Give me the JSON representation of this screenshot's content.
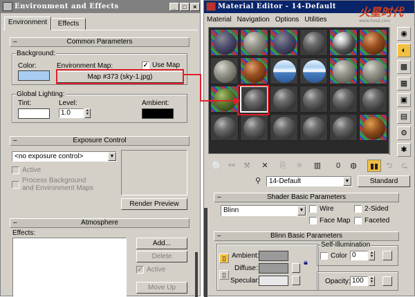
{
  "env_window": {
    "title": "Environment and Effects",
    "tabs": [
      "Environment",
      "Effects"
    ],
    "common_params": {
      "header": "Common Parameters",
      "background_group": "Background:",
      "color_label": "Color:",
      "color_value": "#a9cdf2",
      "env_map_label": "Environment Map:",
      "use_map_label": "Use Map",
      "use_map_checked": true,
      "map_button": "Map #373 (sky-1.jpg)",
      "global_lighting_group": "Global Lighting:",
      "tint_label": "Tint:",
      "level_label": "Level:",
      "level_value": "1.0",
      "ambient_label": "Ambient:"
    },
    "exposure": {
      "header": "Exposure Control",
      "dropdown": "<no exposure control>",
      "active_label": "Active",
      "process_bg_label_1": "Process Background",
      "process_bg_label_2": "and Environment Maps",
      "render_preview": "Render Preview"
    },
    "atmosphere": {
      "header": "Atmosphere",
      "effects_label": "Effects:",
      "add": "Add...",
      "delete": "Delete",
      "active_label": "Active",
      "move_up": "Move Up"
    }
  },
  "mat_window": {
    "title": "Material Editor - 14-Default",
    "menu": [
      "Material",
      "Navigation",
      "Options",
      "Utilities"
    ],
    "watermark": "火星时代",
    "watermark_url": "www.hxsd.com",
    "material_name": "14-Default",
    "material_type": "Standard",
    "shader": {
      "header": "Shader Basic Parameters",
      "shader_value": "Blinn",
      "wire": "Wire",
      "two_sided": "2-Sided",
      "face_map": "Face Map",
      "faceted": "Faceted"
    },
    "blinn": {
      "header": "Blinn Basic Parameters",
      "self_illum_group": "Self-Illumination",
      "color_label": "Color",
      "color_value": "0",
      "ambient": "Ambient:",
      "diffuse": "Diffuse:",
      "specular": "Specular:",
      "opacity_label": "Opacity:",
      "opacity_value": "100"
    },
    "toolbar_icon": "0"
  }
}
